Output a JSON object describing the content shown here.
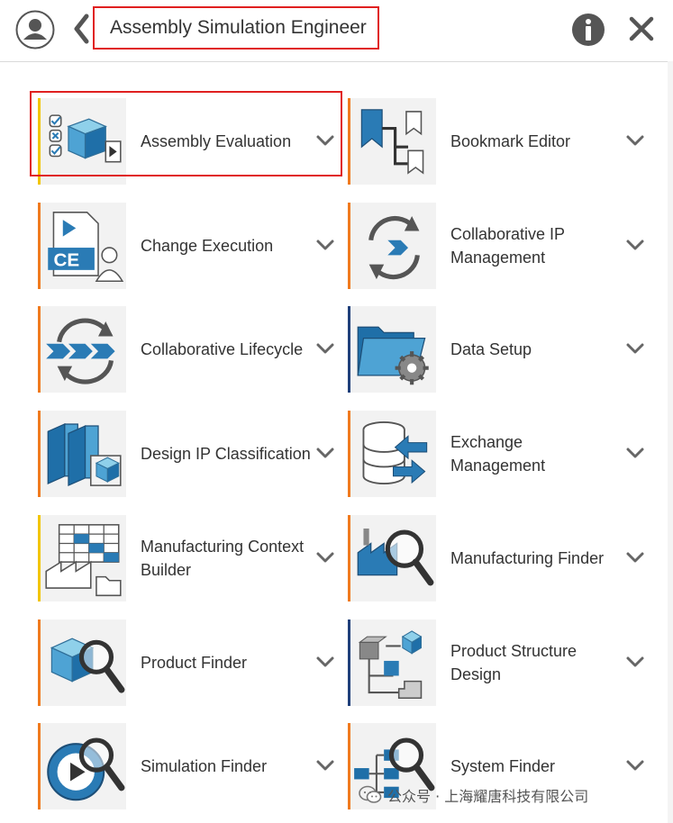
{
  "header": {
    "title": "Assembly Simulation Engineer"
  },
  "tiles": [
    {
      "label": "Assembly Evaluation",
      "accent": "#f2c500",
      "icon": "assembly-evaluation-icon"
    },
    {
      "label": "Bookmark Editor",
      "accent": "#f07a1e",
      "icon": "bookmark-editor-icon"
    },
    {
      "label": "Change Execution",
      "accent": "#f07a1e",
      "icon": "change-execution-icon"
    },
    {
      "label": "Collaborative IP Management",
      "accent": "#f07a1e",
      "icon": "collaborative-ip-icon"
    },
    {
      "label": "Collaborative Lifecycle",
      "accent": "#f07a1e",
      "icon": "collaborative-lifecycle-icon"
    },
    {
      "label": "Data Setup",
      "accent": "#1f3f7a",
      "icon": "data-setup-icon"
    },
    {
      "label": "Design IP Classification",
      "accent": "#f07a1e",
      "icon": "design-ip-classification-icon"
    },
    {
      "label": "Exchange Management",
      "accent": "#f07a1e",
      "icon": "exchange-management-icon"
    },
    {
      "label": "Manufacturing Context Builder",
      "accent": "#f2c500",
      "icon": "manufacturing-context-icon"
    },
    {
      "label": "Manufacturing Finder",
      "accent": "#f07a1e",
      "icon": "manufacturing-finder-icon"
    },
    {
      "label": "Product Finder",
      "accent": "#f07a1e",
      "icon": "product-finder-icon"
    },
    {
      "label": "Product Structure Design",
      "accent": "#1f3f7a",
      "icon": "product-structure-icon"
    },
    {
      "label": "Simulation Finder",
      "accent": "#f07a1e",
      "icon": "simulation-finder-icon"
    },
    {
      "label": "System Finder",
      "accent": "#f07a1e",
      "icon": "system-finder-icon"
    }
  ],
  "watermark": {
    "text": "公众号 · 上海耀唐科技有限公司"
  }
}
